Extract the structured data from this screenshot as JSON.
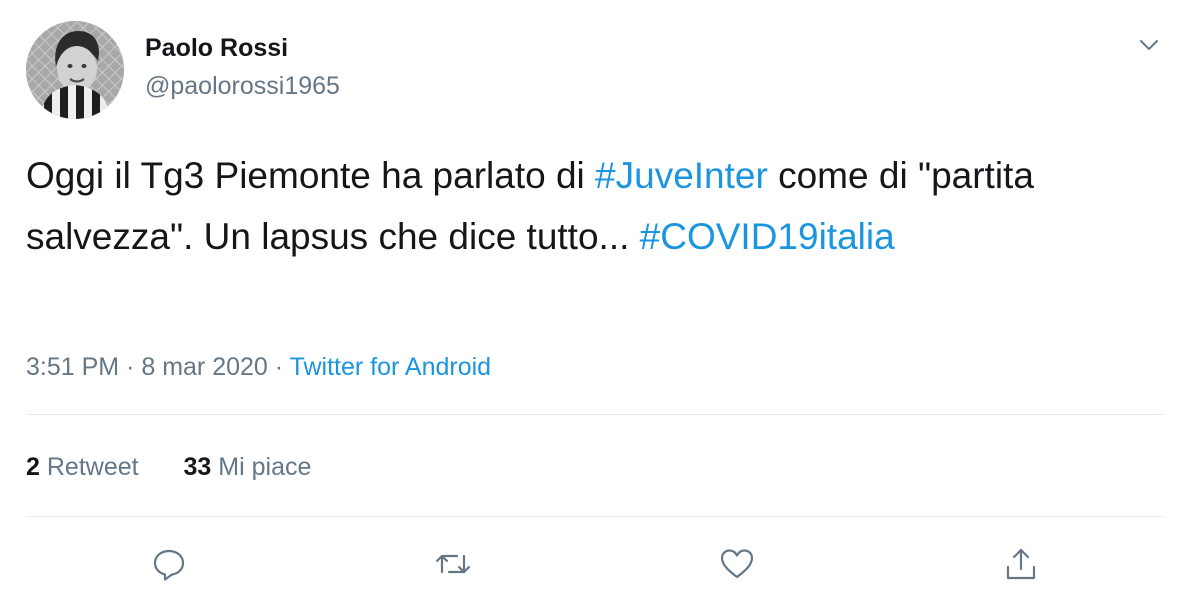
{
  "author": {
    "display_name": "Paolo Rossi",
    "handle": "@paolorossi1965"
  },
  "tweet": {
    "text_parts": [
      {
        "text": "Oggi il Tg3 Piemonte ha parlato di ",
        "type": "text"
      },
      {
        "text": "#JuveInter",
        "type": "hashtag"
      },
      {
        "text": " come di \"partita salvezza\". Un lapsus che dice tutto... ",
        "type": "text"
      },
      {
        "text": "#COVID19italia",
        "type": "hashtag"
      }
    ]
  },
  "meta": {
    "time": "3:51 PM",
    "separator": "·",
    "date": "8 mar 2020",
    "source": "Twitter for Android"
  },
  "stats": {
    "retweets_count": "2",
    "retweets_label": "Retweet",
    "likes_count": "33",
    "likes_label": "Mi piace"
  },
  "icons": {
    "caret": "chevron-down-icon",
    "reply": "reply-icon",
    "retweet": "retweet-icon",
    "like": "heart-icon",
    "share": "share-icon"
  },
  "colors": {
    "link": "#1b95e0",
    "text": "#14171a",
    "secondary": "#657786",
    "divider": "#e6ecf0"
  }
}
